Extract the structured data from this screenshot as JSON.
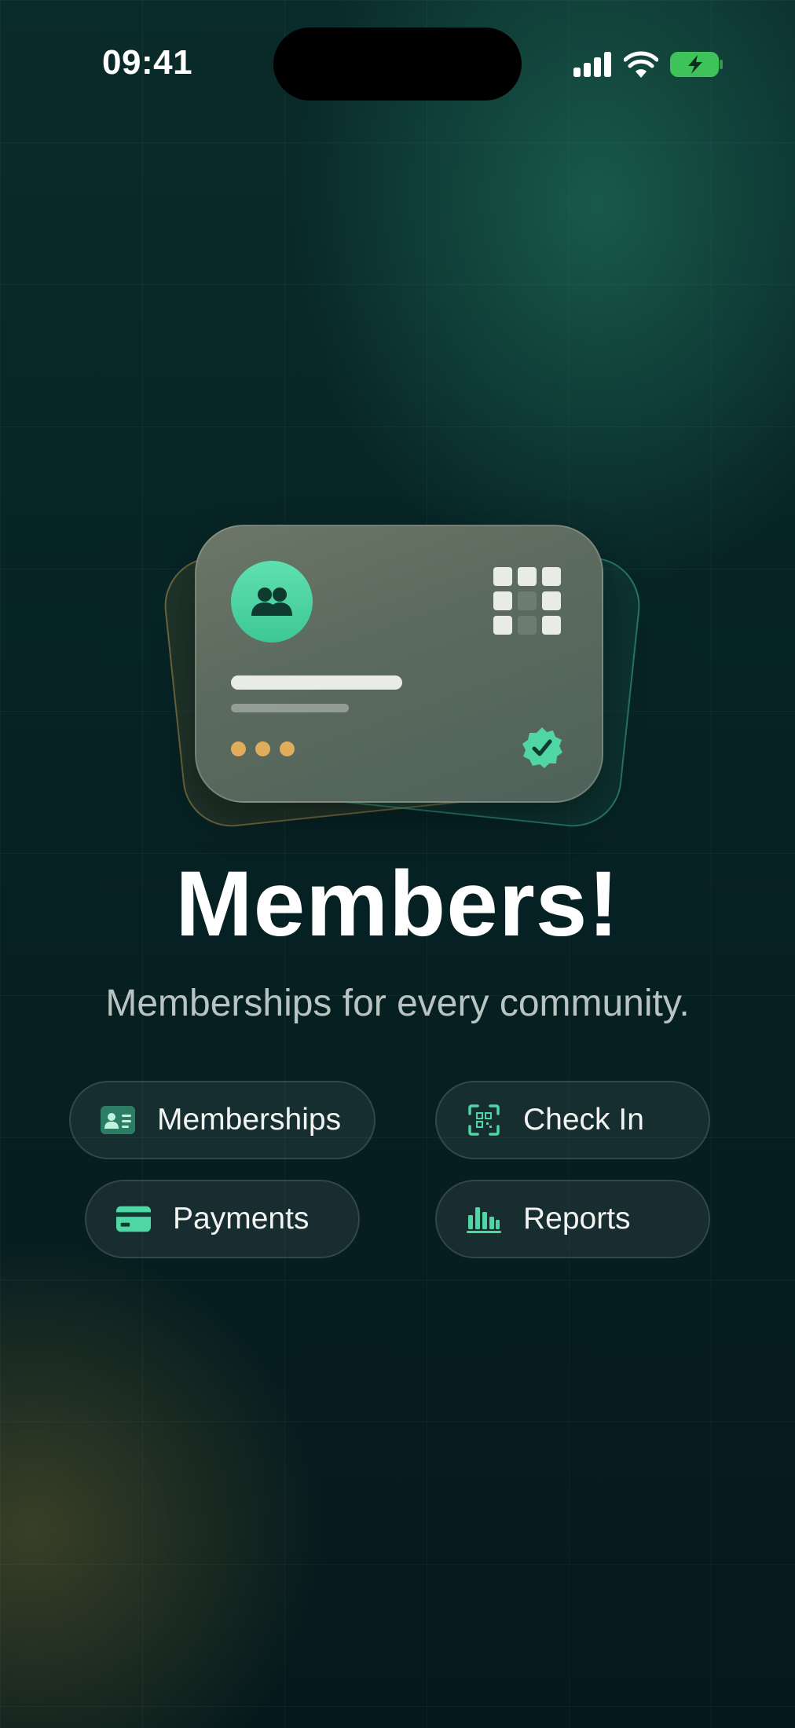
{
  "status_bar": {
    "time": "09:41",
    "icons": [
      "cellular-signal-icon",
      "wifi-icon",
      "battery-charging-icon"
    ]
  },
  "hero": {
    "card_icons": [
      "people-icon",
      "qr-code-icon",
      "verified-badge-icon"
    ],
    "colors": {
      "accent_green": "#4fd6a4",
      "accent_gold": "#e0ad5a"
    }
  },
  "title": "Members!",
  "subtitle": "Memberships for every community.",
  "actions": [
    {
      "label": "Memberships",
      "icon": "id-card-icon"
    },
    {
      "label": "Check In",
      "icon": "qr-scan-icon"
    },
    {
      "label": "Payments",
      "icon": "credit-card-icon"
    },
    {
      "label": "Reports",
      "icon": "bar-chart-icon"
    }
  ]
}
